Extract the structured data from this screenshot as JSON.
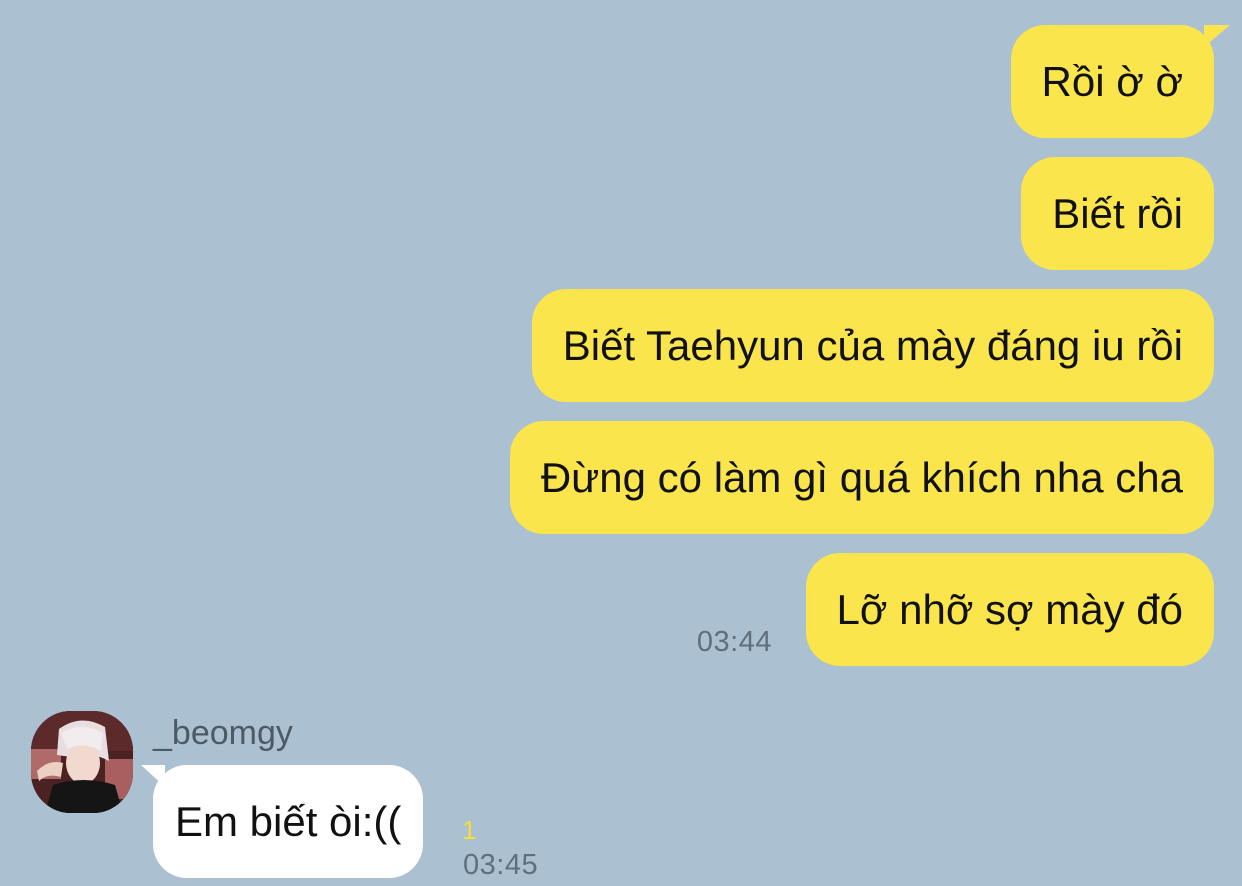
{
  "outgoing": [
    {
      "text": "Rồi ờ ờ"
    },
    {
      "text": "Biết rồi"
    },
    {
      "text": "Biết Taehyun của mày đáng iu rồi"
    },
    {
      "text": "Đừng có làm gì quá khích nha cha"
    },
    {
      "text": "Lỡ nhỡ sợ mày đó",
      "time": "03:44"
    }
  ],
  "incoming": {
    "sender": "_beomgy",
    "text": "Em biết òi:((",
    "unread_count": "1",
    "time": "03:45"
  },
  "colors": {
    "background": "#abc1d1",
    "outgoing_bubble": "#fae54d",
    "incoming_bubble": "#ffffff",
    "unread": "#f5df3a"
  }
}
